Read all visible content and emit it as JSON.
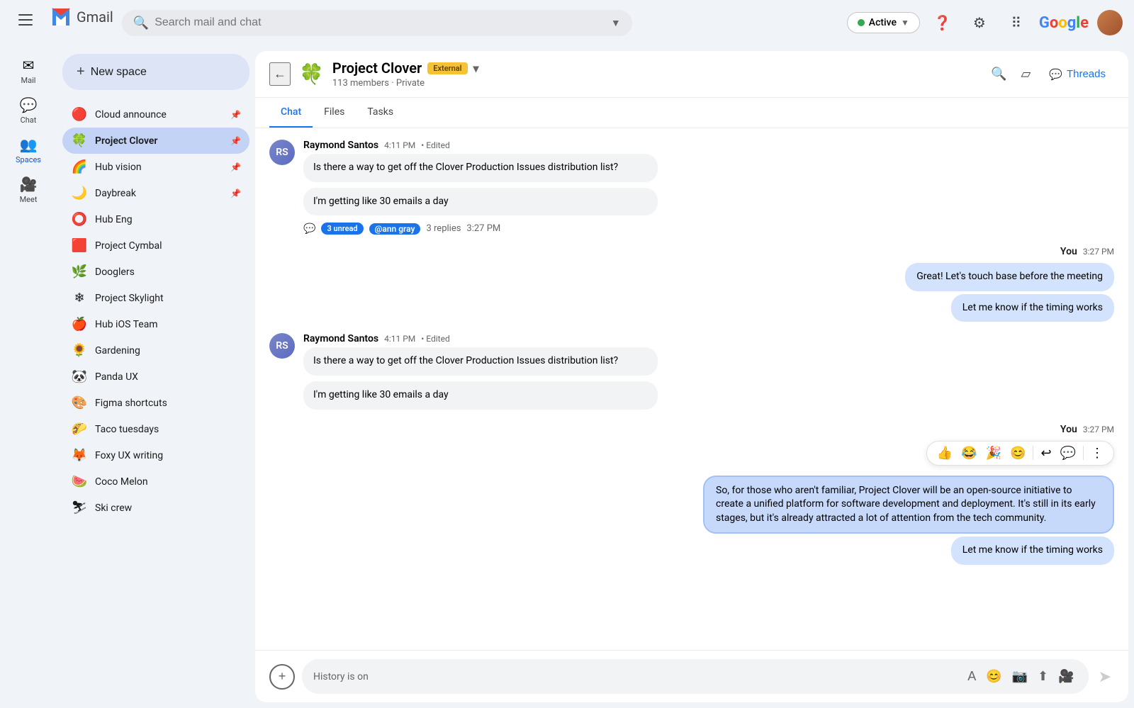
{
  "topbar": {
    "search_placeholder": "Search mail and chat",
    "status": "Active",
    "gmail_text": "Gmail"
  },
  "nav": {
    "items": [
      {
        "id": "mail",
        "label": "Mail",
        "icon": "✉"
      },
      {
        "id": "chat",
        "label": "Chat",
        "icon": "💬"
      },
      {
        "id": "spaces",
        "label": "Spaces",
        "icon": "👥",
        "active": true
      },
      {
        "id": "meet",
        "label": "Meet",
        "icon": "🎥"
      }
    ]
  },
  "sidebar": {
    "new_space_label": "New space",
    "spaces": [
      {
        "id": "cloud-announce",
        "name": "Cloud announce",
        "emoji": "🔴",
        "pinned": true
      },
      {
        "id": "project-clover",
        "name": "Project Clover",
        "emoji": "🍀",
        "pinned": true,
        "active": true
      },
      {
        "id": "hub-vision",
        "name": "Hub vision",
        "emoji": "🌈",
        "pinned": true
      },
      {
        "id": "daybreak",
        "name": "Daybreak",
        "emoji": "🌙",
        "pinned": true
      },
      {
        "id": "hub-eng",
        "name": "Hub Eng",
        "emoji": "⭕"
      },
      {
        "id": "project-cymbal",
        "name": "Project Cymbal",
        "emoji": "🟥"
      },
      {
        "id": "dooglers",
        "name": "Dooglers",
        "emoji": "🌿"
      },
      {
        "id": "project-skylight",
        "name": "Project Skylight",
        "emoji": "❄"
      },
      {
        "id": "hub-ios-team",
        "name": "Hub iOS Team",
        "emoji": "🍎"
      },
      {
        "id": "gardening",
        "name": "Gardening",
        "emoji": "🌻"
      },
      {
        "id": "panda-ux",
        "name": "Panda UX",
        "emoji": "🐼"
      },
      {
        "id": "figma-shortcuts",
        "name": "Figma shortcuts",
        "emoji": "🎨"
      },
      {
        "id": "taco-tuesdays",
        "name": "Taco tuesdays",
        "emoji": "🌮"
      },
      {
        "id": "foxy-ux-writing",
        "name": "Foxy UX writing",
        "emoji": "🦊"
      },
      {
        "id": "coco-melon",
        "name": "Coco Melon",
        "emoji": "🍉"
      },
      {
        "id": "ski-crew",
        "name": "Ski crew",
        "emoji": "⛷"
      }
    ]
  },
  "chat_header": {
    "space_name": "Project Clover",
    "external_badge": "External",
    "members_info": "113 members · Private",
    "threads_label": "Threads"
  },
  "tabs": {
    "items": [
      {
        "id": "chat",
        "label": "Chat",
        "active": true
      },
      {
        "id": "files",
        "label": "Files"
      },
      {
        "id": "tasks",
        "label": "Tasks"
      }
    ]
  },
  "messages": [
    {
      "id": "msg1",
      "sender": "Raymond Santos",
      "time": "4:11 PM",
      "edited": true,
      "bubbles": [
        "Is there a way to get off the Clover Production Issues distribution list?",
        "I'm getting like 30 emails a day"
      ],
      "thread": {
        "unread": "3 unread",
        "mention": "@ann gray",
        "replies": "3 replies",
        "time": "3:27 PM"
      }
    },
    {
      "id": "msg2-sent",
      "sender": "You",
      "time": "3:27 PM",
      "sent": true,
      "bubbles": [
        "Great! Let's touch base before the meeting",
        "Let me know if the timing works"
      ]
    },
    {
      "id": "msg3",
      "sender": "Raymond Santos",
      "time": "4:11 PM",
      "edited": true,
      "bubbles": [
        "Is there a way to get off the Clover Production Issues distribution list?",
        "I'm getting like 30 emails a day"
      ]
    },
    {
      "id": "msg4-sent",
      "sender": "You",
      "time": "3:27 PM",
      "sent": true,
      "highlighted": true,
      "bubbles": [
        "So, for those who aren't familiar, Project Clover will be an open-source initiative to create a unified platform for software development and deployment. It's still in its early stages, but it's already attracted a lot of attention from the tech community.",
        "Let me know if the timing works"
      ],
      "reactions": [
        "👍",
        "😂",
        "🎉",
        "😊",
        "↩",
        "💬",
        "⋮"
      ]
    }
  ],
  "input": {
    "placeholder": "History is on"
  }
}
